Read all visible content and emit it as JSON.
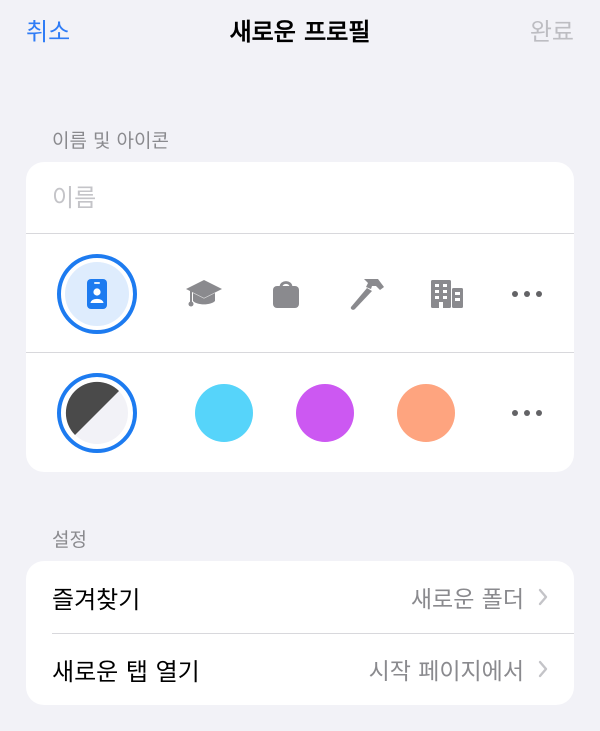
{
  "nav": {
    "cancel": "취소",
    "title": "새로운 프로필",
    "done": "완료"
  },
  "name_section": {
    "header": "이름 및 아이콘",
    "name_placeholder": "이름",
    "icons": [
      "id-badge-icon",
      "graduation-cap-icon",
      "bag-icon",
      "hammer-icon",
      "building-icon",
      "more-icon"
    ],
    "selected_icon": "id-badge-icon",
    "colors": [
      {
        "name": "auto-dark-light",
        "hex": "#4a4a4a"
      },
      {
        "name": "cyan",
        "hex": "#56d4fa"
      },
      {
        "name": "purple",
        "hex": "#cc58f2"
      },
      {
        "name": "orange",
        "hex": "#fea47f"
      }
    ],
    "selected_color": "auto-dark-light"
  },
  "settings_section": {
    "header": "설정",
    "rows": [
      {
        "label": "즐겨찾기",
        "value": "새로운 폴더"
      },
      {
        "label": "새로운 탭 열기",
        "value": "시작 페이지에서"
      }
    ]
  },
  "colors": {
    "accent": "#1d7bf0",
    "background": "#f2f2f7",
    "disabled": "#bdbdc2"
  }
}
